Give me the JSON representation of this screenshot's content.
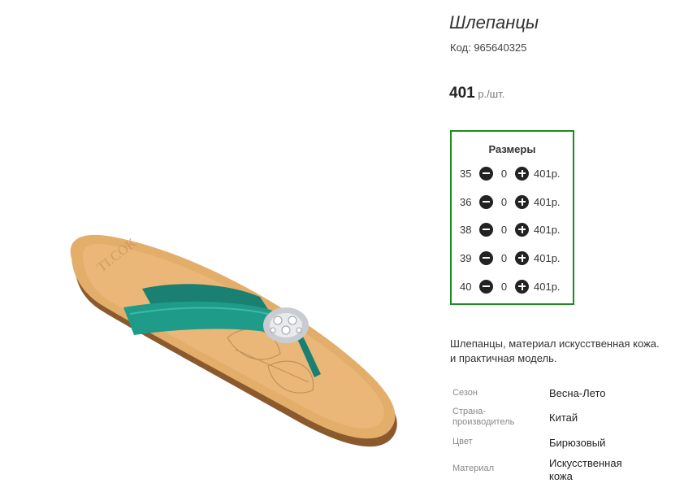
{
  "product": {
    "title": "Шлепанцы",
    "code": "Код: 965640325",
    "price_amount": "401",
    "price_unit": "р./шт."
  },
  "sizes": {
    "title": "Размеры",
    "rows": [
      {
        "size": "35",
        "qty": "0",
        "price": "401р."
      },
      {
        "size": "36",
        "qty": "0",
        "price": "401р."
      },
      {
        "size": "38",
        "qty": "0",
        "price": "401р."
      },
      {
        "size": "39",
        "qty": "0",
        "price": "401р."
      },
      {
        "size": "40",
        "qty": "0",
        "price": "401р."
      }
    ]
  },
  "description": {
    "line1": "Шлепанцы, материал искусственная кожа.",
    "line2": "и практичная модель."
  },
  "specs": [
    {
      "label": "Сезон",
      "value": "Весна-Лето"
    },
    {
      "label": "Страна-производитель",
      "value": "Китай"
    },
    {
      "label": "Цвет",
      "value": "Бирюзовый"
    },
    {
      "label": "Материал",
      "value": "Искусственная кожа"
    }
  ],
  "image": {
    "sole_print": "TI.COK"
  },
  "colors": {
    "box_border": "#1f8a1f",
    "strap": "#1f9b8a",
    "sole": "#e3ad6a"
  }
}
